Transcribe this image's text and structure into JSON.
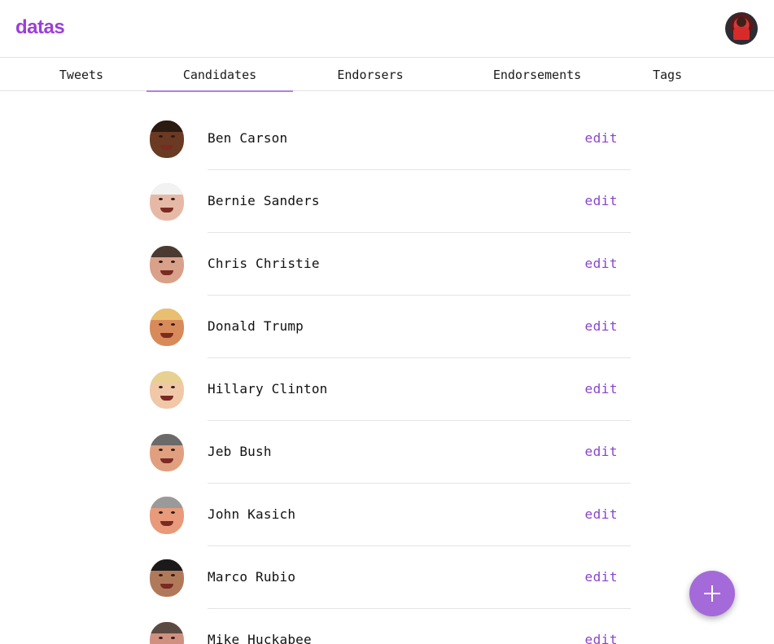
{
  "app": {
    "logo_text": "datas",
    "accent_color": "#9b3fd8"
  },
  "header": {
    "avatar_icon": "user-avatar"
  },
  "tabs": [
    {
      "label": "Tweets",
      "active": false
    },
    {
      "label": "Candidates",
      "active": true
    },
    {
      "label": "Endorsers",
      "active": false
    },
    {
      "label": "Endorsements",
      "active": false
    },
    {
      "label": "Tags",
      "active": false
    }
  ],
  "candidates": [
    {
      "name": "Ben Carson",
      "action": "edit",
      "skin": "#6b3a22",
      "hair": "#2a1a12"
    },
    {
      "name": "Bernie Sanders",
      "action": "edit",
      "skin": "#e6b9a6",
      "hair": "#f2f2f2"
    },
    {
      "name": "Chris Christie",
      "action": "edit",
      "skin": "#d9a08a",
      "hair": "#4a3a32"
    },
    {
      "name": "Donald Trump",
      "action": "edit",
      "skin": "#d98a5a",
      "hair": "#e8c070"
    },
    {
      "name": "Hillary Clinton",
      "action": "edit",
      "skin": "#f0c8a8",
      "hair": "#e8d090"
    },
    {
      "name": "Jeb Bush",
      "action": "edit",
      "skin": "#e0a080",
      "hair": "#6a6a6a"
    },
    {
      "name": "John Kasich",
      "action": "edit",
      "skin": "#e89a7a",
      "hair": "#9a9a9a"
    },
    {
      "name": "Marco Rubio",
      "action": "edit",
      "skin": "#b07a5a",
      "hair": "#1a1a1a"
    },
    {
      "name": "Mike Huckabee",
      "action": "edit",
      "skin": "#d09080",
      "hair": "#5a4a42"
    }
  ],
  "fab": {
    "icon": "plus-icon"
  }
}
